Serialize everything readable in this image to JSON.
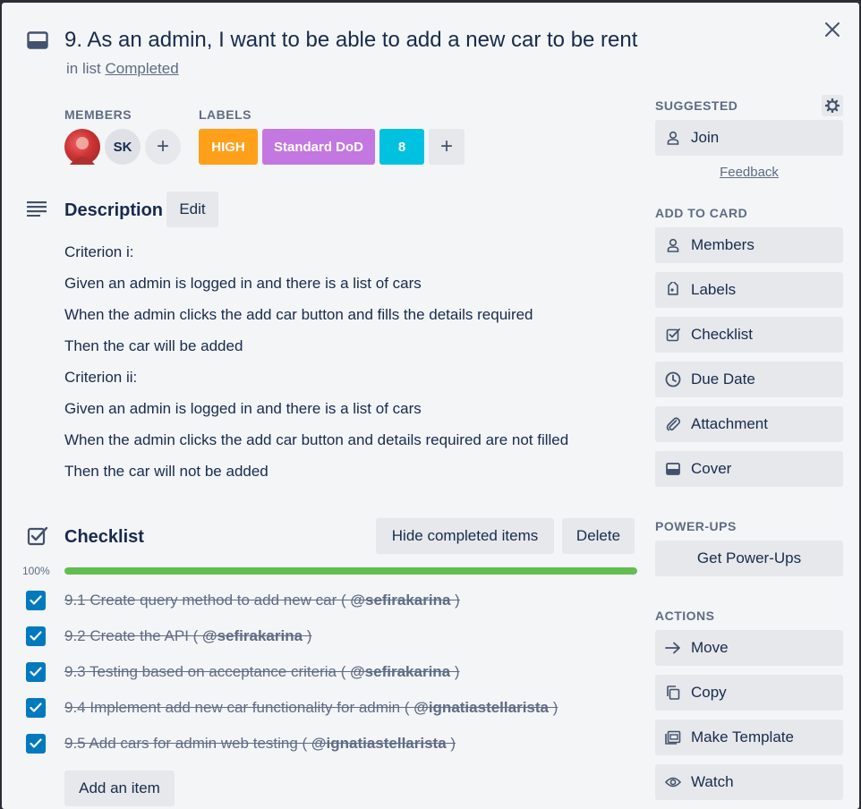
{
  "card": {
    "title": "9. As an admin, I want to be able to add a new car to be rent",
    "in_list_prefix": "in list",
    "list_name": "Completed"
  },
  "members": {
    "heading": "MEMBERS",
    "avatars": [
      {
        "initials": "",
        "kind": "photo"
      },
      {
        "initials": "SK",
        "kind": "initials"
      }
    ],
    "add_label": "+"
  },
  "labels": {
    "heading": "LABELS",
    "items": [
      {
        "text": "HIGH",
        "color": "#ff9f1a"
      },
      {
        "text": "Standard DoD",
        "color": "#c377e0"
      },
      {
        "text": "8",
        "color": "#00c2e0"
      }
    ],
    "add_label": "+"
  },
  "description": {
    "heading": "Description",
    "edit_label": "Edit",
    "lines": [
      "Criterion i:",
      "Given an admin is logged in and there is a list of cars",
      "When the admin clicks the add car button and fills the details required",
      "Then the car will be added",
      "Criterion ii:",
      "Given an admin is logged in and there is a list of cars",
      "When the admin clicks the add car button and details required are not filled",
      "Then the car will not be added"
    ]
  },
  "checklist": {
    "heading": "Checklist",
    "hide_label": "Hide completed items",
    "delete_label": "Delete",
    "progress_text": "100%",
    "progress": 1.0,
    "progress_color": "#61bd4f",
    "items": [
      {
        "text": "9.1 Create query method to add new car ( ",
        "mention": "@sefirakarina",
        "suffix": " )",
        "checked": true
      },
      {
        "text": "9.2 Create the API ( ",
        "mention": "@sefirakarina",
        "suffix": " )",
        "checked": true
      },
      {
        "text": "9.3 Testing based on acceptance criteria ( ",
        "mention": "@sefirakarina",
        "suffix": " )",
        "checked": true
      },
      {
        "text": "9.4 Implement add new car functionality for admin ( ",
        "mention": "@ignatiastellarista",
        "suffix": " )",
        "checked": true
      },
      {
        "text": "9.5 Add cars for admin web testing ( ",
        "mention": "@ignatiastellarista",
        "suffix": " )",
        "checked": true
      }
    ],
    "add_item_label": "Add an item"
  },
  "sidebar": {
    "suggested_heading": "SUGGESTED",
    "join_label": "Join",
    "feedback_label": "Feedback",
    "add_to_card_heading": "ADD TO CARD",
    "add_to_card": [
      {
        "label": "Members",
        "icon": "person-icon"
      },
      {
        "label": "Labels",
        "icon": "tag-icon"
      },
      {
        "label": "Checklist",
        "icon": "checklist-icon"
      },
      {
        "label": "Due Date",
        "icon": "clock-icon"
      },
      {
        "label": "Attachment",
        "icon": "paperclip-icon"
      },
      {
        "label": "Cover",
        "icon": "cover-icon"
      }
    ],
    "powerups_heading": "POWER-UPS",
    "get_powerups_label": "Get Power-Ups",
    "actions_heading": "ACTIONS",
    "actions": [
      {
        "label": "Move",
        "icon": "arrow-right-icon"
      },
      {
        "label": "Copy",
        "icon": "copy-icon"
      },
      {
        "label": "Make Template",
        "icon": "template-icon"
      },
      {
        "label": "Watch",
        "icon": "eye-icon"
      }
    ]
  }
}
